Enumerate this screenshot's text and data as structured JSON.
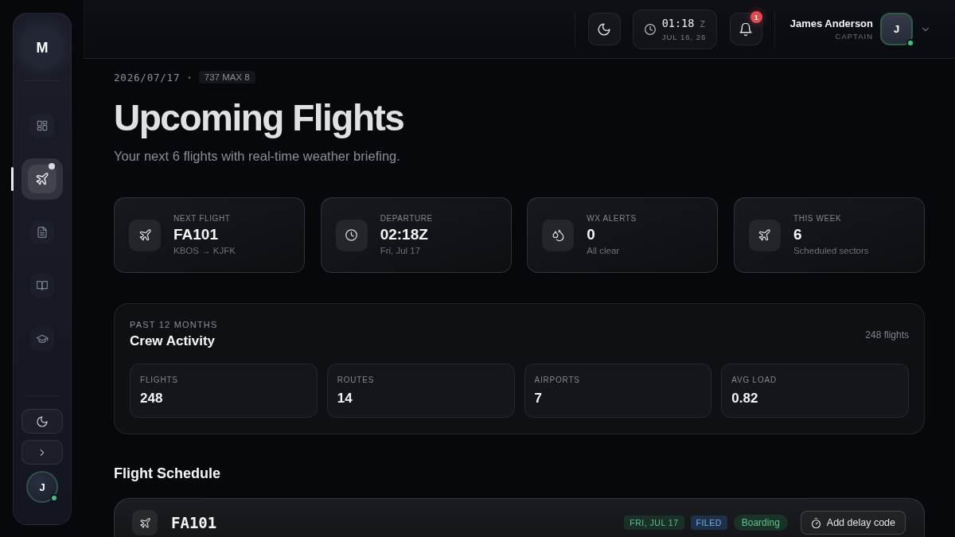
{
  "sidebar": {
    "logo": "M",
    "items": [
      {
        "selected": false,
        "notification": false
      },
      {
        "selected": true,
        "notification": true
      },
      {
        "selected": false,
        "notification": false
      },
      {
        "selected": false,
        "notification": false
      },
      {
        "selected": false,
        "notification": false
      }
    ],
    "avatar": {
      "initial": "J",
      "online": true
    }
  },
  "topbar": {
    "clock": {
      "time": "01:18",
      "zone": "Z",
      "date": "JUL 16, 26"
    },
    "notifications": {
      "count": "1"
    },
    "user": {
      "name": "James Anderson",
      "role": "CAPTAIN",
      "initial": "J",
      "online": true
    }
  },
  "header": {
    "date": "2026/07/17",
    "separator": "•",
    "aircraft": "737 MAX 8",
    "title": "Upcoming Flights",
    "subtitle": "Your next 6 flights with real-time weather briefing."
  },
  "stats": [
    {
      "label": "NEXT FLIGHT",
      "value": "FA101",
      "detail": "KBOS → KJFK"
    },
    {
      "label": "DEPARTURE",
      "value": "02:18Z",
      "detail": "Fri, Jul 17"
    },
    {
      "label": "WX ALERTS",
      "value": "0",
      "detail": "All clear"
    },
    {
      "label": "THIS WEEK",
      "value": "6",
      "detail": "Scheduled sectors"
    }
  ],
  "crew_activity": {
    "eyebrow": "PAST 12 MONTHS",
    "title": "Crew Activity",
    "total": "248 flights",
    "metrics": [
      {
        "label": "FLIGHTS",
        "value": "248"
      },
      {
        "label": "ROUTES",
        "value": "14"
      },
      {
        "label": "AIRPORTS",
        "value": "7"
      },
      {
        "label": "AVG LOAD",
        "value": "0.82"
      }
    ]
  },
  "schedule": {
    "title": "Flight Schedule",
    "flights": [
      {
        "code": "FA101",
        "tags": [
          {
            "kind": "date",
            "text": "FRI, JUL 17"
          },
          {
            "kind": "filed",
            "text": "FILED"
          },
          {
            "kind": "status",
            "text": "Boarding"
          }
        ],
        "action": "Add delay code"
      }
    ]
  }
}
